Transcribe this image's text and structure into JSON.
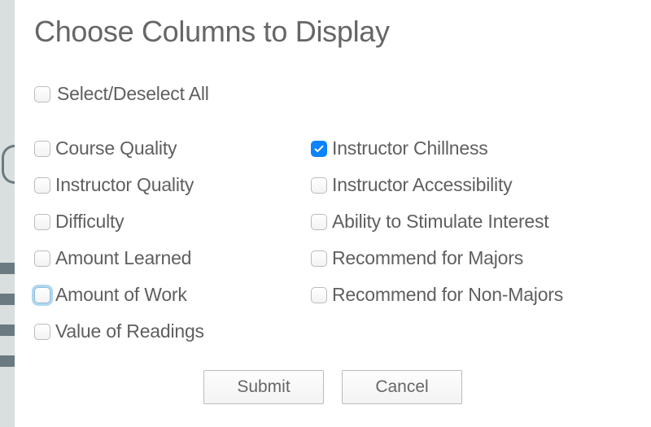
{
  "title": "Choose Columns to Display",
  "selectAll": {
    "label": "Select/Deselect All",
    "checked": false
  },
  "optionsLeft": [
    {
      "key": "course-quality",
      "label": "Course Quality",
      "checked": false,
      "focused": false
    },
    {
      "key": "instructor-quality",
      "label": "Instructor Quality",
      "checked": false,
      "focused": false
    },
    {
      "key": "difficulty",
      "label": "Difficulty",
      "checked": false,
      "focused": false
    },
    {
      "key": "amount-learned",
      "label": "Amount Learned",
      "checked": false,
      "focused": false
    },
    {
      "key": "amount-of-work",
      "label": "Amount of Work",
      "checked": false,
      "focused": true
    },
    {
      "key": "value-of-readings",
      "label": "Value of Readings",
      "checked": false,
      "focused": false
    }
  ],
  "optionsRight": [
    {
      "key": "instructor-chillness",
      "label": "Instructor Chillness",
      "checked": true,
      "focused": false
    },
    {
      "key": "instructor-accessibility",
      "label": "Instructor Accessibility",
      "checked": false,
      "focused": false
    },
    {
      "key": "ability-to-stimulate-interest",
      "label": "Ability to Stimulate Interest",
      "checked": false,
      "focused": false
    },
    {
      "key": "recommend-for-majors",
      "label": "Recommend for Majors",
      "checked": false,
      "focused": false
    },
    {
      "key": "recommend-for-non-majors",
      "label": "Recommend for Non-Majors",
      "checked": false,
      "focused": false
    }
  ],
  "buttons": {
    "submit": "Submit",
    "cancel": "Cancel"
  }
}
